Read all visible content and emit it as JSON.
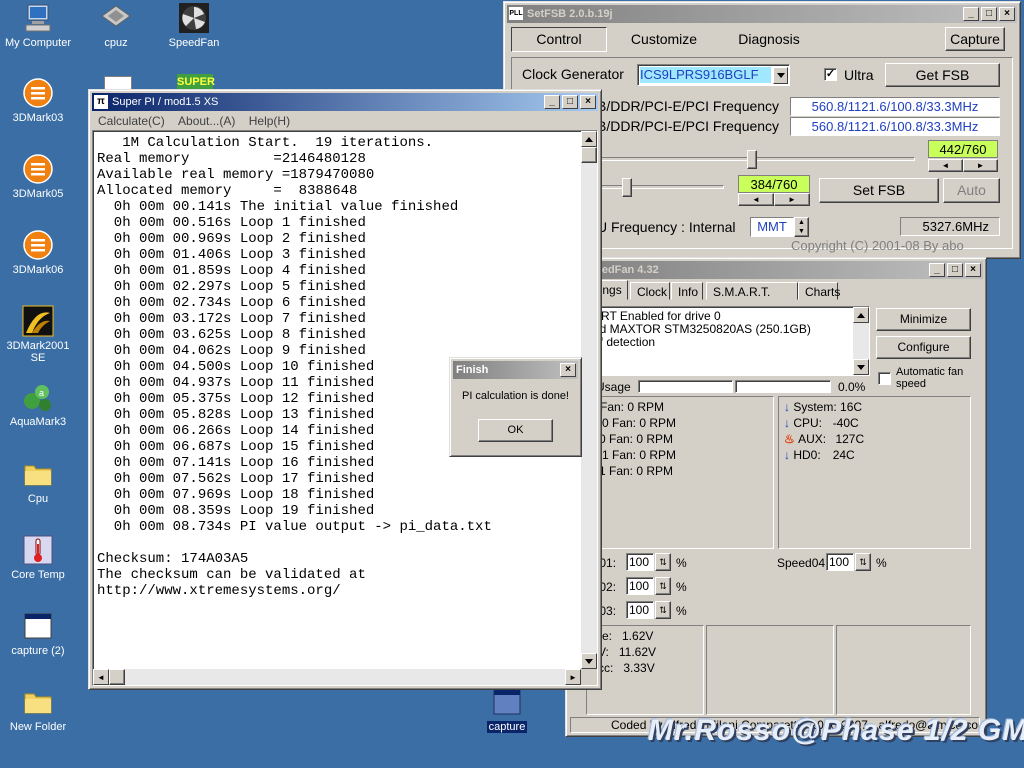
{
  "desktop": {
    "icons": [
      {
        "label": "My Computer"
      },
      {
        "label": "cpuz"
      },
      {
        "label": "SpeedFan"
      },
      {
        "label": "3DMark03"
      },
      {
        "label": "3DMark05"
      },
      {
        "label": "3DMark06"
      },
      {
        "label": "3DMark2001 SE"
      },
      {
        "label": "AquaMark3"
      },
      {
        "label": "Cpu"
      },
      {
        "label": "Core Temp"
      },
      {
        "label": "capture (2)"
      },
      {
        "label": "New Folder"
      },
      {
        "label": "capture"
      }
    ],
    "watermark": "Mr.Rosso@Phase 1/2 GM",
    "colors": {
      "background": "#3a6ea5"
    }
  },
  "superpi": {
    "title": "Super PI / mod1.5 XS",
    "menu": [
      "Calculate(C)",
      "About...(A)",
      "Help(H)"
    ],
    "output_lines": [
      "   1M Calculation Start.  19 iterations.",
      "Real memory          =2146480128",
      "Available real memory =1879470080",
      "Allocated memory     =  8388648",
      "  0h 00m 00.141s The initial value finished",
      "  0h 00m 00.516s Loop 1 finished",
      "  0h 00m 00.969s Loop 2 finished",
      "  0h 00m 01.406s Loop 3 finished",
      "  0h 00m 01.859s Loop 4 finished",
      "  0h 00m 02.297s Loop 5 finished",
      "  0h 00m 02.734s Loop 6 finished",
      "  0h 00m 03.172s Loop 7 finished",
      "  0h 00m 03.625s Loop 8 finished",
      "  0h 00m 04.062s Loop 9 finished",
      "  0h 00m 04.500s Loop 10 finished",
      "  0h 00m 04.937s Loop 11 finished",
      "  0h 00m 05.375s Loop 12 finished",
      "  0h 00m 05.828s Loop 13 finished",
      "  0h 00m 06.266s Loop 14 finished",
      "  0h 00m 06.687s Loop 15 finished",
      "  0h 00m 07.141s Loop 16 finished",
      "  0h 00m 07.562s Loop 17 finished",
      "  0h 00m 07.969s Loop 18 finished",
      "  0h 00m 08.359s Loop 19 finished",
      "  0h 00m 08.734s PI value output -> pi_data.txt",
      "",
      "Checksum: 174A03A5",
      "The checksum can be validated at",
      "http://www.xtremesystems.org/"
    ]
  },
  "finish_dialog": {
    "title": "Finish",
    "message": "PI calculation is done!",
    "ok_label": "OK"
  },
  "setfsb": {
    "title": "SetFSB 2.0.b.19j",
    "tabs": [
      "Control",
      "Customize",
      "Diagnosis"
    ],
    "capture_label": "Capture",
    "clock_generator_label": "Clock Generator",
    "clock_generator_value": "ICS9LPRS916BGLF",
    "ultra_label": "Ultra",
    "get_fsb_label": "Get FSB",
    "freq_label_1": "B/DDR/PCI-E/PCI Frequency",
    "freq_value_1": "560.8/1121.6/100.8/33.3MHz",
    "freq_label_2": "B/DDR/PCI-E/PCI Frequency",
    "freq_value_2": "560.8/1121.6/100.8/33.3MHz",
    "slider1_value": "442/760",
    "slider2_value": "384/760",
    "set_fsb_label": "Set FSB",
    "auto_label": "Auto",
    "cpu_freq_label": "U Frequency : Internal",
    "mmt_label": "MMT",
    "cpu_freq_value": "5327.6MHz",
    "copyright": "Copyright (C) 2001-08 By abo",
    "colors": {
      "lcd_text": "#2040c0",
      "green": "#c8ff5a"
    }
  },
  "speedfan": {
    "title": "peedFan 4.32",
    "tabs": [
      "dings",
      "Clock",
      "Info",
      "S.M.A.R.T.",
      "Charts"
    ],
    "log_lines": [
      "ART Enabled for drive 0",
      "nd MAXTOR STM3250820AS (250.1GB)",
      " of detection"
    ],
    "minimize_label": "Minimize",
    "configure_label": "Configure",
    "auto_fan_label": "Automatic fan speed",
    "usage_label": " Usage",
    "usage_value": "0.0%",
    "fans": [
      " Fan: 0 RPM",
      "J0 Fan: 0 RPM",
      "0 Fan: 0 RPM",
      "J1 Fan: 0 RPM",
      "1 Fan: 0 RPM"
    ],
    "temps": [
      {
        "name": "System:",
        "value": "16C",
        "icon": "arrow-down"
      },
      {
        "name": "CPU:",
        "value": "-40C",
        "icon": "arrow-down"
      },
      {
        "name": "AUX:",
        "value": "127C",
        "icon": "fire"
      },
      {
        "name": "HD0:",
        "value": "24C",
        "icon": "arrow-down"
      }
    ],
    "speeds": [
      {
        "label": "ed01:",
        "value": "100",
        "unit": "%"
      },
      {
        "label": "ed02:",
        "value": "100",
        "unit": "%"
      },
      {
        "label": "ed03:",
        "value": "100",
        "unit": "%"
      }
    ],
    "speed04": {
      "label": "Speed04:",
      "value": "100",
      "unit": "%"
    },
    "voltages": [
      "re:   1.62V",
      "V:   11.62V",
      "cc:   3.33V"
    ],
    "footer": "Coded by Alfredo Milani Comparetti - 2000-2007 - alfredo@almico.com"
  }
}
